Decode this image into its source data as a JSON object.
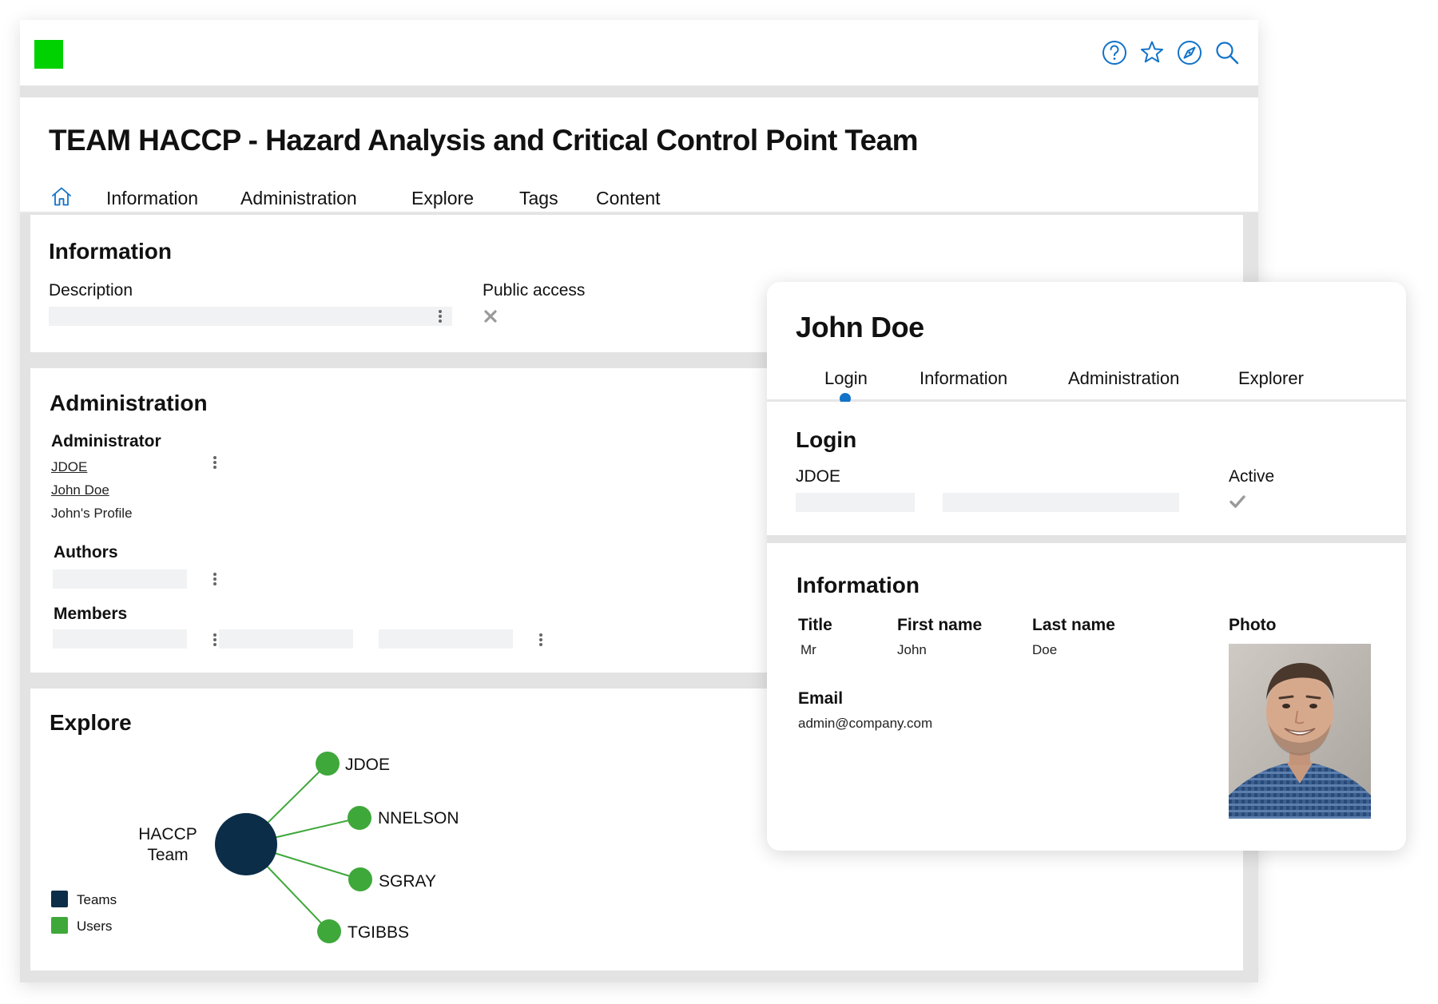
{
  "team": {
    "title": "TEAM HACCP - Hazard Analysis and Critical Control Point Team",
    "tabs": [
      "Information",
      "Administration",
      "Explore",
      "Tags",
      "Content"
    ],
    "active_tab": "Information",
    "top_icons": [
      "help-icon",
      "star-icon",
      "compass-icon",
      "search-icon"
    ],
    "accent_color": "#1273c9",
    "logo_color": "#00d100"
  },
  "information": {
    "heading": "Information",
    "description_label": "Description",
    "public_access_label": "Public access",
    "public_access_icon": "cross-icon"
  },
  "administration": {
    "heading": "Administration",
    "administrator_label": "Administrator",
    "admin_login": "JDOE",
    "admin_name": "John Doe",
    "admin_profile": "John's Profile",
    "authors_label": "Authors",
    "members_label": "Members"
  },
  "explore": {
    "heading": "Explore",
    "center_node": [
      "HACCP",
      "Team"
    ],
    "nodes": [
      "JDOE",
      "NNELSON",
      "SGRAY",
      "TGIBBS"
    ],
    "legend": [
      {
        "label": "Teams",
        "color": "#0b2d48"
      },
      {
        "label": "Users",
        "color": "#3ea83a"
      }
    ]
  },
  "user": {
    "name": "John Doe",
    "tabs": [
      "Login",
      "Information",
      "Administration",
      "Explorer"
    ],
    "active_tab": "Login",
    "login": {
      "heading": "Login",
      "login_value": "JDOE",
      "active_label": "Active",
      "active_icon": "check-icon"
    },
    "info": {
      "heading": "Information",
      "title_label": "Title",
      "title_value": "Mr",
      "first_name_label": "First name",
      "first_name_value": "John",
      "last_name_label": "Last name",
      "last_name_value": "Doe",
      "photo_label": "Photo",
      "email_label": "Email",
      "email_value": "admin@company.com"
    }
  }
}
